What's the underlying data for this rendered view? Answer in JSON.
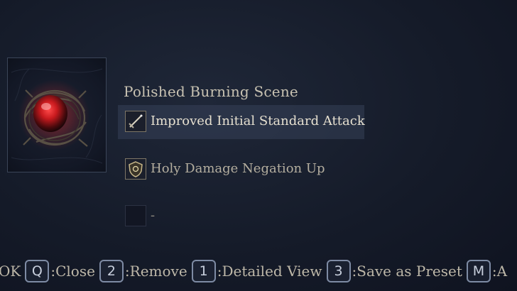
{
  "relic": {
    "name": "Polished Burning Scene"
  },
  "effects": [
    {
      "label": "Improved Initial Standard Attack",
      "icon": "sword-icon",
      "selected": true
    },
    {
      "label": "Holy Damage Negation Up",
      "icon": "shield-icon",
      "selected": false
    },
    {
      "label": "-",
      "icon": "empty-slot-icon",
      "selected": false
    }
  ],
  "hints": {
    "ok_text": "OK",
    "close_key": "Q",
    "close_text": ":Close",
    "remove_key": "2",
    "remove_text": ":Remove",
    "detail_key": "1",
    "detail_text": ":Detailed View",
    "preset_key": "3",
    "preset_text": ":Save as Preset",
    "more_key": "M",
    "more_text": ":A"
  }
}
